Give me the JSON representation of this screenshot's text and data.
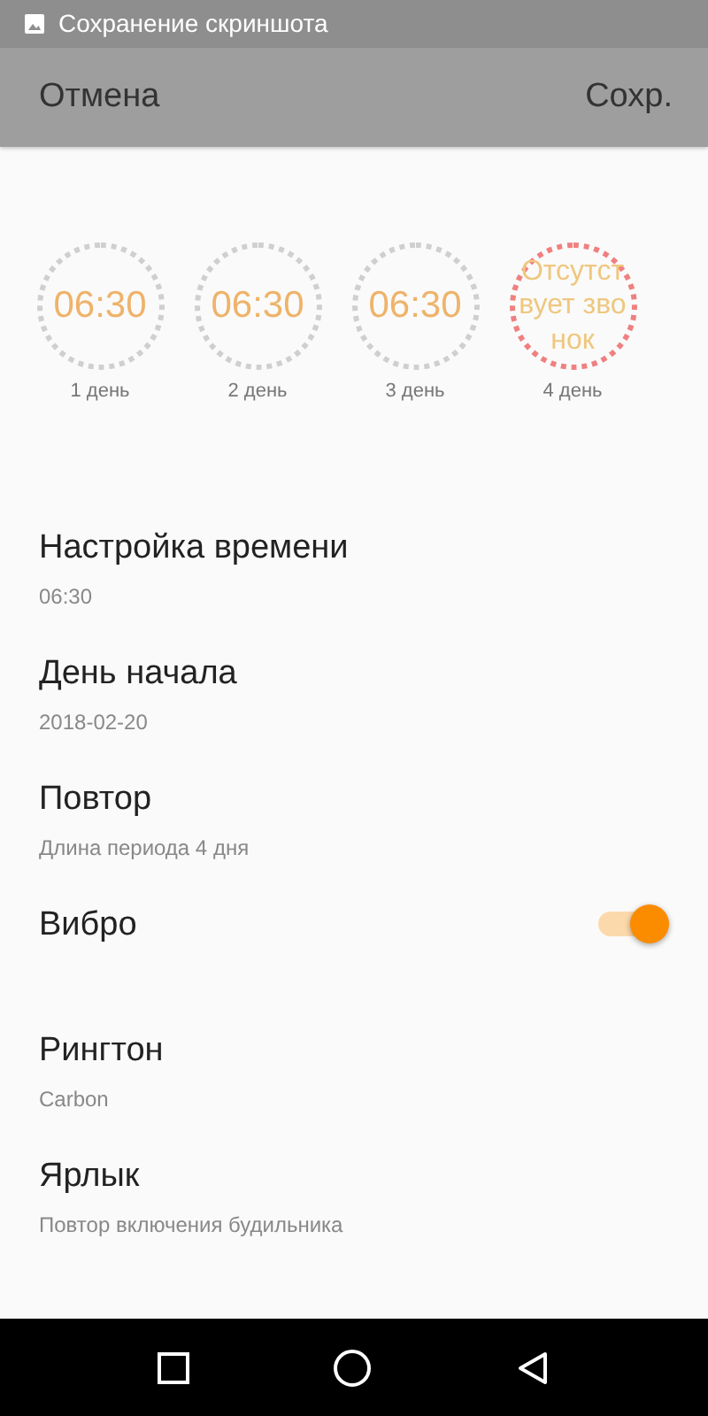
{
  "status_bar": {
    "notification": "Сохранение скриншота"
  },
  "toolbar": {
    "cancel": "Отмена",
    "save": "Сохр."
  },
  "days": [
    {
      "time": "06:30",
      "label": "1 день",
      "kind": "alarm"
    },
    {
      "time": "06:30",
      "label": "2 день",
      "kind": "alarm"
    },
    {
      "time": "06:30",
      "label": "3 день",
      "kind": "alarm"
    },
    {
      "time": "Отсутствует звонок",
      "label": "4 день",
      "kind": "off"
    }
  ],
  "settings": [
    {
      "kind": "text",
      "title": "Настройка времени",
      "subtitle": "06:30"
    },
    {
      "kind": "text",
      "title": "День начала",
      "subtitle": "2018-02-20"
    },
    {
      "kind": "text",
      "title": "Повтор",
      "subtitle": "Длина периода  4 дня"
    },
    {
      "kind": "switch",
      "title": "Вибро",
      "on": true
    },
    {
      "kind": "text",
      "title": "Рингтон",
      "subtitle": "Carbon"
    },
    {
      "kind": "text",
      "title": "Ярлык",
      "subtitle": "Повтор включения будильника"
    }
  ]
}
